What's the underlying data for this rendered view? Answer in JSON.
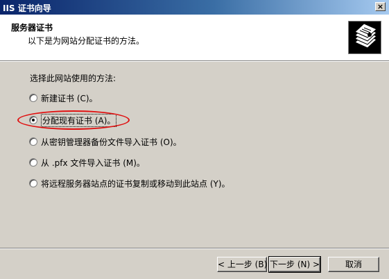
{
  "window": {
    "title": "IIS 证书向导",
    "close_label": "×"
  },
  "header": {
    "title": "服务器证书",
    "subtitle": "以下是为网站分配证书的方法。",
    "icon": "certificate-stack-icon"
  },
  "main": {
    "prompt": "选择此网站使用的方法:",
    "options": [
      {
        "label": "新建证书 (C)。",
        "selected": false
      },
      {
        "label": "分配现有证书 (A)。",
        "selected": true
      },
      {
        "label": "从密钥管理器备份文件导入证书 (O)。",
        "selected": false
      },
      {
        "label": "从 .pfx 文件导入证书 (M)。",
        "selected": false
      },
      {
        "label": "将远程服务器站点的证书复制或移动到此站点 (Y)。",
        "selected": false
      }
    ]
  },
  "footer": {
    "back_label": "< 上一步 (B)",
    "next_label": "下一步 (N) >",
    "cancel_label": "取消"
  },
  "colors": {
    "titlebar_start": "#0a246a",
    "titlebar_end": "#a6caf0",
    "dialog_bg": "#d4d0c8",
    "annotation_red": "#e01010"
  }
}
